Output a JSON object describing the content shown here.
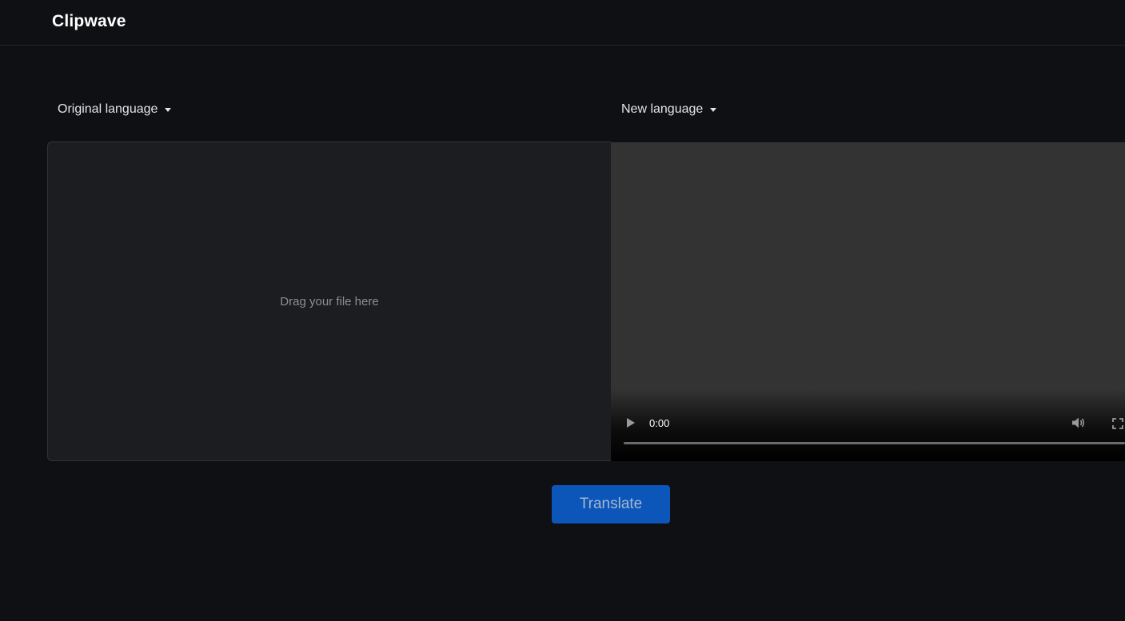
{
  "app": {
    "title": "Clipwave"
  },
  "languages": {
    "original_label": "Original language",
    "new_label": "New language"
  },
  "dropzone": {
    "text": "Drag your file here"
  },
  "video": {
    "current_time": "0:00",
    "progress": 0
  },
  "actions": {
    "translate_label": "Translate"
  },
  "colors": {
    "background": "#0f1013",
    "dropzone": "#1c1d20",
    "video": "#333333",
    "primary_button": "#0b56b8"
  },
  "icons": {
    "original_dropdown": "caret-down-icon",
    "new_dropdown": "caret-down-icon",
    "play": "play-icon",
    "volume": "volume-icon",
    "fullscreen": "fullscreen-icon"
  }
}
